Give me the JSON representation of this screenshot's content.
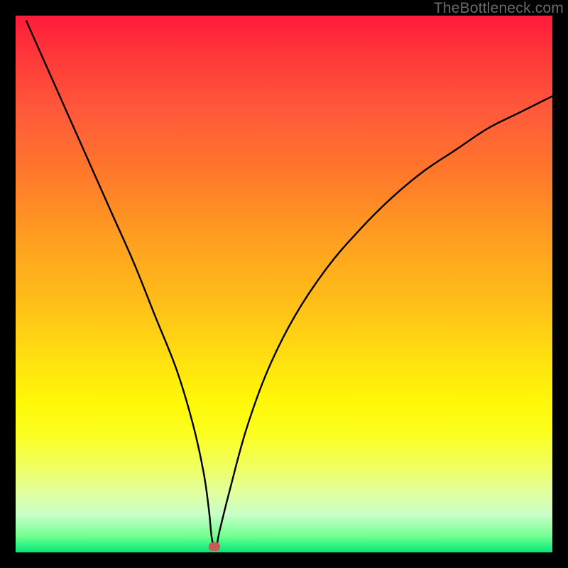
{
  "watermark": "TheBottleneck.com",
  "chart_data": {
    "type": "line",
    "title": "",
    "xlabel": "",
    "ylabel": "",
    "xlim": [
      0,
      100
    ],
    "ylim": [
      0,
      100
    ],
    "grid": false,
    "series": [
      {
        "name": "curve",
        "x": [
          2,
          6,
          10,
          14,
          18,
          22,
          26,
          30,
          33,
          35,
          36,
          36.5,
          37,
          37.5,
          38,
          40,
          43,
          47,
          52,
          58,
          64,
          70,
          76,
          82,
          88,
          94,
          100
        ],
        "y": [
          99,
          90,
          81,
          72,
          63,
          54,
          44,
          34,
          24,
          15,
          8,
          3,
          1,
          1.5,
          4,
          12,
          23,
          34,
          44,
          53,
          60,
          66,
          71,
          75,
          79,
          82,
          85
        ]
      }
    ],
    "marker": {
      "x": 37,
      "y": 1
    },
    "gradient_stops": [
      {
        "pos": 0,
        "color": "#ff1a3a"
      },
      {
        "pos": 50,
        "color": "#ffd010"
      },
      {
        "pos": 80,
        "color": "#f8ff30"
      },
      {
        "pos": 100,
        "color": "#00e878"
      }
    ]
  }
}
